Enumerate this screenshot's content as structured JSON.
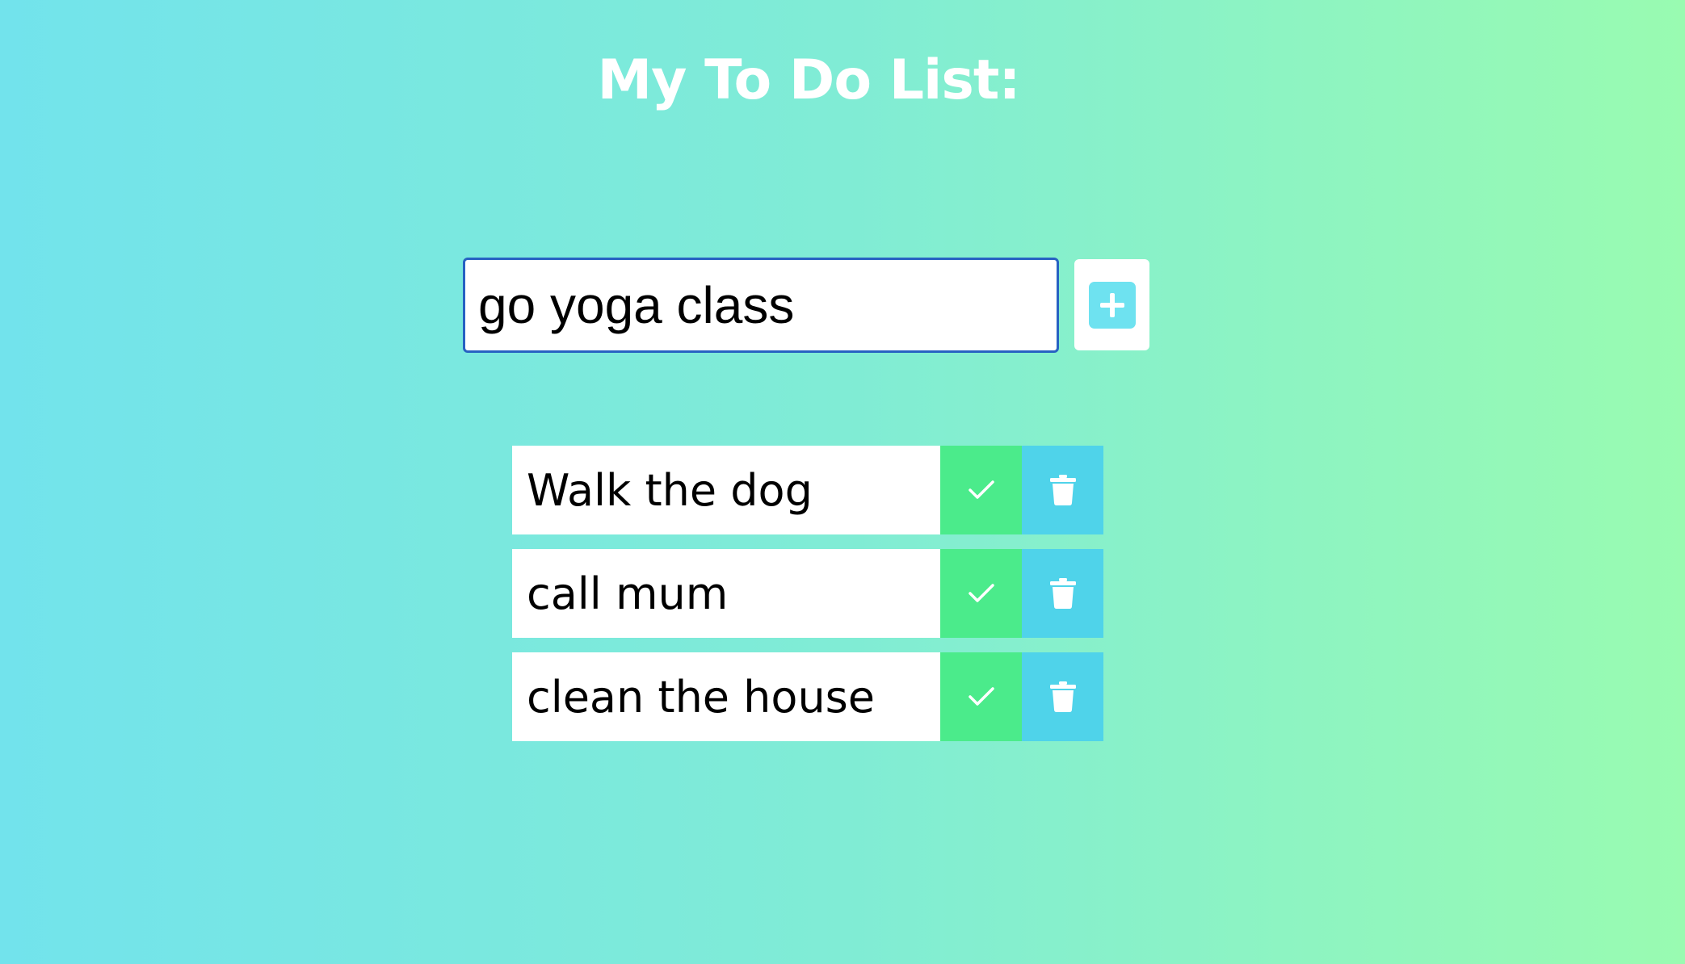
{
  "header": {
    "title": "My To Do List:"
  },
  "input": {
    "value": "go yoga class",
    "placeholder": ""
  },
  "add_button": {
    "icon": "plus-square-icon"
  },
  "todos": [
    {
      "text": "Walk the dog"
    },
    {
      "text": "call mum"
    },
    {
      "text": "clean the house"
    }
  ],
  "item_actions": {
    "complete_icon": "check-icon",
    "delete_icon": "trash-icon"
  },
  "colors": {
    "background_start": "#72e3ec",
    "background_end": "#99fbb1",
    "complete": "#4beb8b",
    "delete": "#4fd3ea",
    "input_border": "#2762c2",
    "add_icon": "#6ee2f0"
  }
}
